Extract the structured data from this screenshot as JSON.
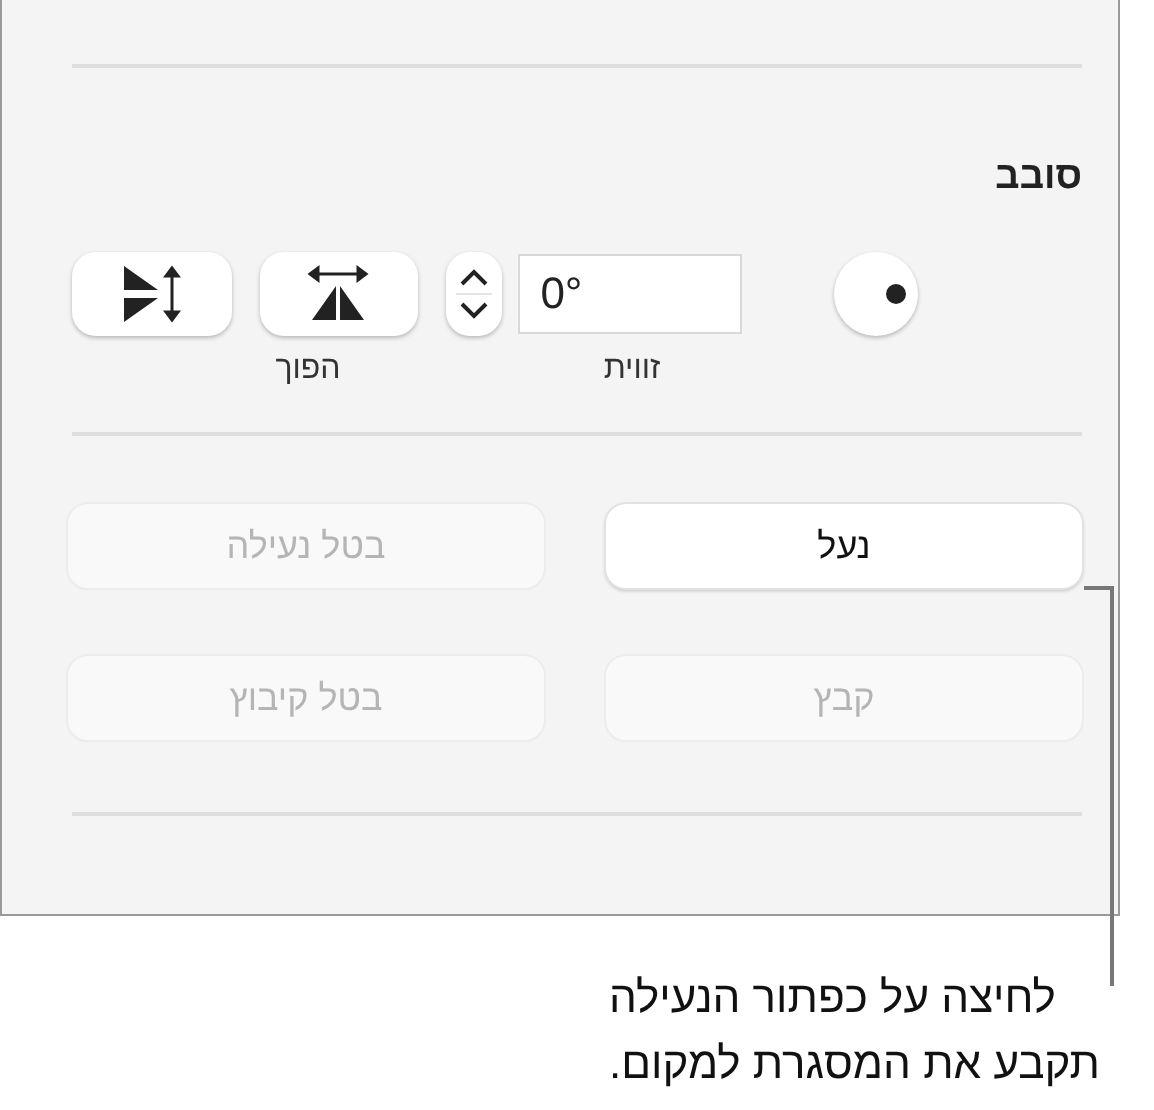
{
  "section": {
    "title": "סובב"
  },
  "rotate": {
    "angle_value": "0°",
    "angle_label": "זווית",
    "flip_label": "הפוך"
  },
  "buttons": [
    {
      "label": "נעל",
      "disabled": false
    },
    {
      "label": "בטל נעילה",
      "disabled": true
    },
    {
      "label": "קבץ",
      "disabled": true
    },
    {
      "label": "בטל קיבוץ",
      "disabled": true
    }
  ],
  "callout_lines": [
    "לחיצה על כפתור הנעילה",
    "תקבע את המסגרת למקום."
  ]
}
